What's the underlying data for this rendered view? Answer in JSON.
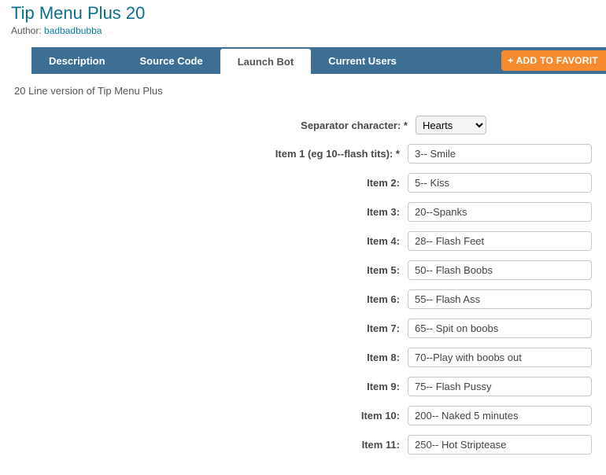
{
  "header": {
    "title": "Tip Menu Plus 20",
    "author_label": "Author: ",
    "author_name": "badbadbubba"
  },
  "tabs": {
    "description": "Description",
    "source_code": "Source Code",
    "launch_bot": "Launch Bot",
    "current_users": "Current Users",
    "add_favorite": "+ ADD TO FAVORIT"
  },
  "content": {
    "description_text": "20 Line version of Tip Menu Plus"
  },
  "form": {
    "separator": {
      "label": "Separator character: *",
      "value": "Hearts"
    },
    "item1": {
      "label": "Item 1 (eg 10--flash tits): *",
      "value": "3-- Smile"
    },
    "item2": {
      "label": "Item 2:",
      "value": "5-- Kiss"
    },
    "item3": {
      "label": "Item 3:",
      "value": "20--Spanks"
    },
    "item4": {
      "label": "Item 4:",
      "value": "28-- Flash Feet"
    },
    "item5": {
      "label": "Item 5:",
      "value": "50-- Flash Boobs"
    },
    "item6": {
      "label": "Item 6:",
      "value": "55-- Flash Ass"
    },
    "item7": {
      "label": "Item 7:",
      "value": "65-- Spit on boobs"
    },
    "item8": {
      "label": "Item 8:",
      "value": "70--Play with boobs out"
    },
    "item9": {
      "label": "Item 9:",
      "value": "75-- Flash Pussy"
    },
    "item10": {
      "label": "Item 10:",
      "value": "200-- Naked 5 minutes"
    },
    "item11": {
      "label": "Item 11:",
      "value": "250-- Hot Striptease"
    }
  }
}
